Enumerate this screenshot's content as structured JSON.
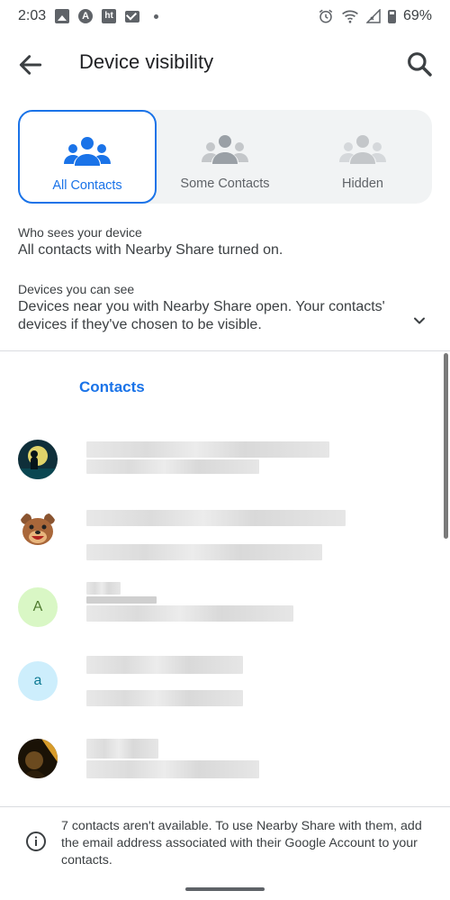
{
  "status_bar": {
    "time": "2:03",
    "battery": "69%"
  },
  "app_bar": {
    "title": "Device visibility"
  },
  "visibility_options": [
    {
      "label": "All Contacts",
      "selected": true
    },
    {
      "label": "Some Contacts",
      "selected": false
    },
    {
      "label": "Hidden",
      "selected": false
    }
  ],
  "who_sees": {
    "label": "Who sees your device",
    "value": "All contacts with Nearby Share turned on."
  },
  "devices_see": {
    "label": "Devices you can see",
    "value_line1": "Devices near you with Nearby Share open. Your contacts'",
    "value_line2": "devices if they've chosen to be visible."
  },
  "contacts": {
    "section_title": "Contacts",
    "items": [
      {
        "avatar_type": "photo",
        "avatar_icon": "silhouette-moon-photo"
      },
      {
        "avatar_type": "photo",
        "avatar_icon": "cartoon-bear-photo"
      },
      {
        "avatar_type": "letter",
        "avatar_letter": "A",
        "avatar_bg": "#d9f7c5",
        "avatar_fg": "#4e7a2e"
      },
      {
        "avatar_type": "letter",
        "avatar_letter": "a",
        "avatar_bg": "#cdeefc",
        "avatar_fg": "#0e7a94"
      },
      {
        "avatar_type": "photo",
        "avatar_icon": "dark-portrait-photo"
      }
    ]
  },
  "footer": {
    "text": "7 contacts aren't available. To use Nearby Share with them, add the email address associated with their Google Account to your contacts."
  },
  "colors": {
    "accent": "#1a73e8",
    "segment_bg": "#f1f3f4",
    "inactive_icon": "#bdc1c6"
  }
}
